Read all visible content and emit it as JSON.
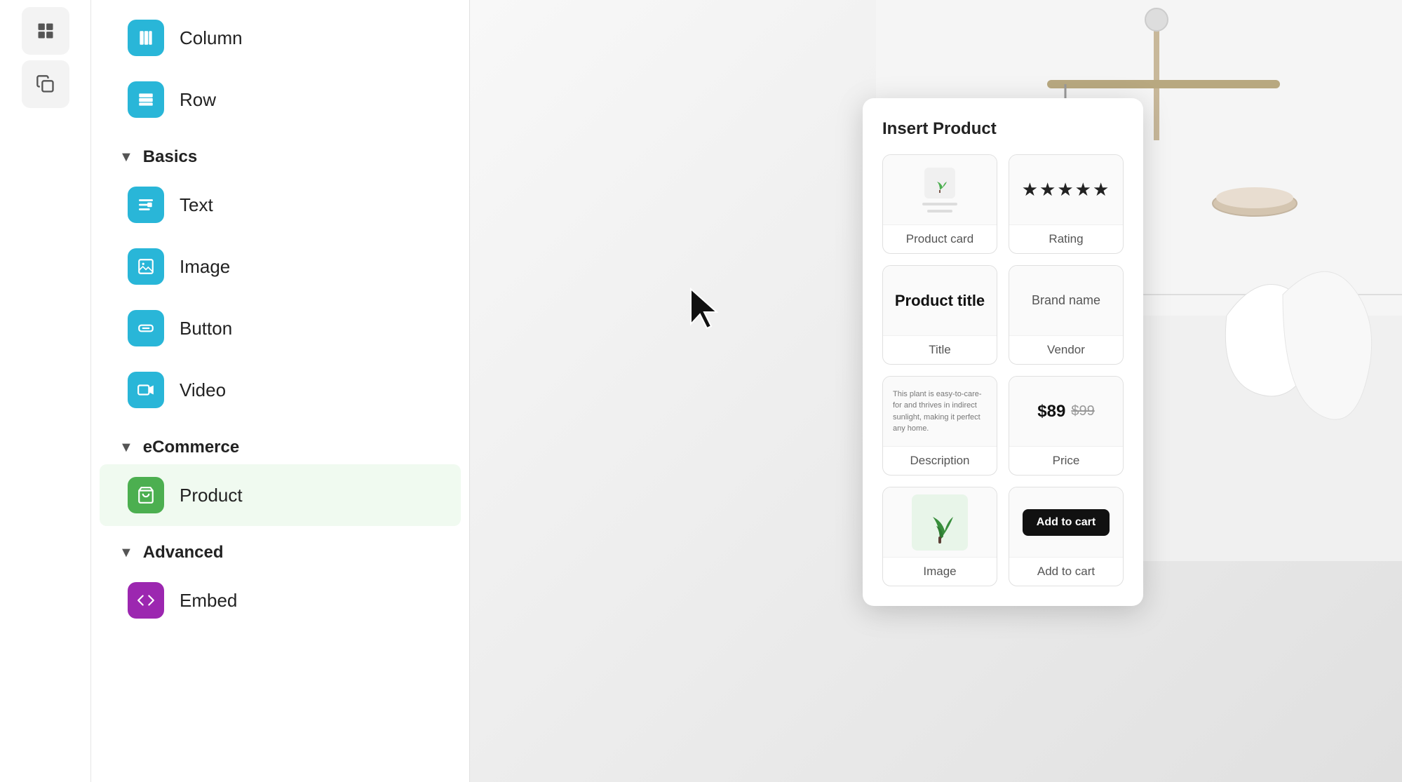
{
  "iconBar": {
    "buttons": [
      {
        "name": "layout-icon",
        "symbol": "⊞"
      },
      {
        "name": "copy-icon",
        "symbol": "❑"
      }
    ]
  },
  "sidebar": {
    "sections": [
      {
        "name": "layout",
        "items": [
          {
            "id": "column",
            "label": "Column",
            "icon": "column",
            "iconBg": "cyan"
          },
          {
            "id": "row",
            "label": "Row",
            "icon": "row",
            "iconBg": "cyan"
          }
        ]
      },
      {
        "name": "Basics",
        "collapsed": false,
        "items": [
          {
            "id": "text",
            "label": "Text",
            "icon": "text",
            "iconBg": "cyan"
          },
          {
            "id": "image",
            "label": "Image",
            "icon": "image",
            "iconBg": "cyan"
          },
          {
            "id": "button",
            "label": "Button",
            "icon": "button",
            "iconBg": "cyan"
          },
          {
            "id": "video",
            "label": "Video",
            "icon": "video",
            "iconBg": "cyan"
          }
        ]
      },
      {
        "name": "eCommerce",
        "collapsed": false,
        "items": [
          {
            "id": "product",
            "label": "Product",
            "icon": "product",
            "iconBg": "green",
            "active": true
          }
        ]
      },
      {
        "name": "Advanced",
        "collapsed": false,
        "items": [
          {
            "id": "embed",
            "label": "Embed",
            "icon": "embed",
            "iconBg": "purple"
          }
        ]
      }
    ]
  },
  "popup": {
    "title": "Insert Product",
    "cards": [
      {
        "id": "product-card",
        "label": "Product card",
        "type": "product-card"
      },
      {
        "id": "rating",
        "label": "Rating",
        "type": "rating"
      },
      {
        "id": "title",
        "label": "Title",
        "type": "title"
      },
      {
        "id": "vendor",
        "label": "Vendor",
        "type": "vendor"
      },
      {
        "id": "description",
        "label": "Description",
        "type": "description"
      },
      {
        "id": "price",
        "label": "Price",
        "type": "price"
      },
      {
        "id": "image",
        "label": "Image",
        "type": "image"
      },
      {
        "id": "add-to-cart",
        "label": "Add to cart",
        "type": "add-to-cart"
      }
    ],
    "preview": {
      "stars": "★★★★★",
      "title": "Product title",
      "vendor": "Brand name",
      "description": "This plant is easy-to-care-for and thrives in indirect sunlight, making it perfect any home.",
      "price": "$89",
      "priceOld": "$99",
      "addToCart": "Add to cart"
    }
  }
}
